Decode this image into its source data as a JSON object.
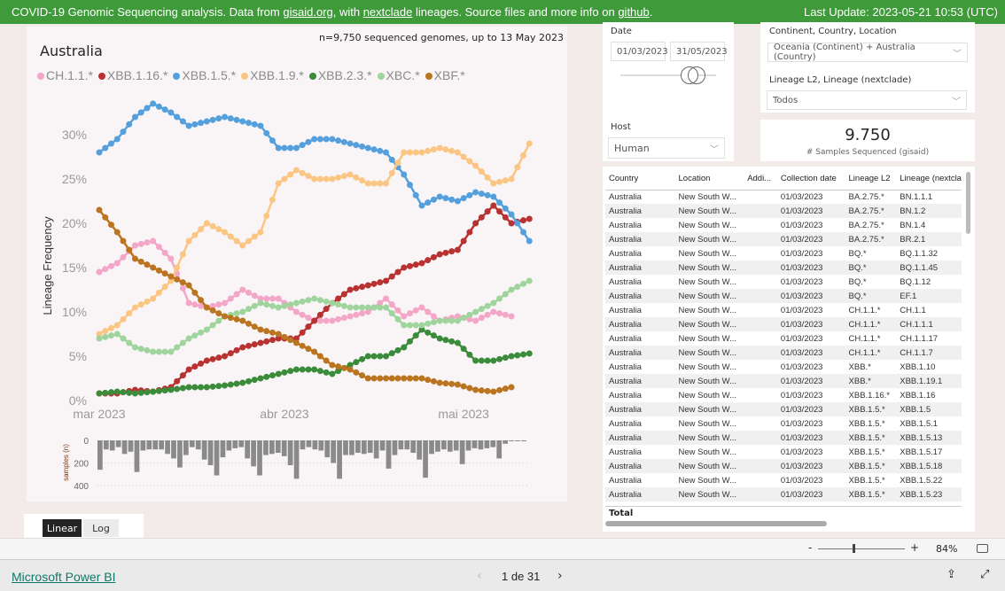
{
  "header": {
    "pre": "COVID-19 Genomic Sequencing analysis. Data from ",
    "link1": "gisaid.org",
    "mid": ", with ",
    "link2": "nextclade",
    "mid2": " lineages. Source files and more info on ",
    "link3": "github",
    "end": ".",
    "last_update": "Last Update: 2023-05-21 10:53 (UTC)"
  },
  "chart": {
    "title": "Australia",
    "count_text": "n=9,750 sequenced genomes, up to 13 May 2023",
    "ylabel": "Lineage Frequency",
    "bar_ylabel": "samples (n)"
  },
  "chart_data": {
    "type": "line",
    "ylabel": "Lineage Frequency",
    "yticks": [
      "0%",
      "5%",
      "10%",
      "15%",
      "20%",
      "25%",
      "30%"
    ],
    "ylim": [
      0,
      32
    ],
    "xticks": [
      "mar 2023",
      "abr 2023",
      "mai 2023"
    ],
    "x": [
      "2023-03-01",
      "2023-03-04",
      "2023-03-07",
      "2023-03-10",
      "2023-03-13",
      "2023-03-16",
      "2023-03-19",
      "2023-03-22",
      "2023-03-25",
      "2023-03-28",
      "2023-03-31",
      "2023-04-03",
      "2023-04-06",
      "2023-04-09",
      "2023-04-12",
      "2023-04-15",
      "2023-04-18",
      "2023-04-21",
      "2023-04-24",
      "2023-04-27",
      "2023-04-30",
      "2023-05-03",
      "2023-05-06",
      "2023-05-09",
      "2023-05-12"
    ],
    "series": [
      {
        "name": "CH.1.1.*",
        "color": "#f4a6c8",
        "values": [
          14.5,
          15.5,
          17.5,
          18,
          16,
          11,
          10.5,
          11,
          12.5,
          11.5,
          11.5,
          10,
          9,
          9,
          9.5,
          10,
          11.5,
          9.5,
          10.5,
          9,
          9.5,
          9,
          10,
          9.5,
          null
        ]
      },
      {
        "name": "XBB.1.16.*",
        "color": "#b83232",
        "values": [
          0.8,
          0.8,
          1.2,
          1,
          1.5,
          3.5,
          4.5,
          5,
          6,
          6.5,
          7,
          7,
          9,
          11,
          12.5,
          13,
          13.5,
          15,
          15.5,
          16.5,
          17,
          20,
          22,
          20,
          20.5
        ]
      },
      {
        "name": "XBB.1.5.*",
        "color": "#55a0dc",
        "values": [
          28,
          29.5,
          32,
          33.5,
          32.5,
          31,
          31.5,
          32,
          31.5,
          31,
          28.5,
          28.5,
          29.5,
          29.5,
          29,
          28.5,
          28,
          25.5,
          22,
          23,
          22.5,
          23.5,
          23,
          21,
          18
        ]
      },
      {
        "name": "XBB.1.9.*",
        "color": "#fbc683",
        "values": [
          7.5,
          8.5,
          10.5,
          11.5,
          13.5,
          18,
          20,
          19,
          17.5,
          19,
          24.5,
          26,
          25,
          25,
          25.5,
          24.5,
          24.5,
          28,
          28,
          28.5,
          28,
          26.5,
          24.5,
          25,
          29
        ]
      },
      {
        "name": "XBB.2.3.*",
        "color": "#3a8b3a",
        "values": [
          0.8,
          1,
          0.8,
          1,
          1.2,
          1.5,
          1.5,
          1.7,
          2,
          2.5,
          3,
          3.5,
          3.5,
          3,
          4,
          5,
          5,
          6,
          8,
          7,
          6.5,
          4.5,
          4.5,
          5,
          5.3
        ]
      },
      {
        "name": "XBC.*",
        "color": "#9fd59c",
        "values": [
          7,
          7.5,
          6,
          5.5,
          5.5,
          7,
          8,
          9.5,
          10,
          11,
          10.5,
          11,
          11.5,
          11,
          10.5,
          10.5,
          10.5,
          8.5,
          8.5,
          9,
          9,
          10,
          11,
          12.5,
          13.5
        ]
      },
      {
        "name": "XBF.*",
        "color": "#bb7420",
        "values": [
          21.5,
          19,
          16,
          15,
          14,
          13,
          10.5,
          9.5,
          9,
          8,
          7.5,
          6.5,
          5.5,
          4,
          3.5,
          2.5,
          2.5,
          2.5,
          2.5,
          2,
          1.8,
          1.2,
          1,
          1.5,
          null
        ]
      }
    ],
    "samples": {
      "yticks": [
        "0",
        "200",
        "400"
      ],
      "ylim": [
        0,
        400
      ],
      "values": [
        260,
        80,
        90,
        60,
        120,
        100,
        280,
        90,
        80,
        80,
        80,
        120,
        160,
        240,
        130,
        60,
        80,
        170,
        220,
        310,
        150,
        90,
        70,
        60,
        160,
        230,
        310,
        130,
        120,
        110,
        140,
        220,
        340,
        80,
        60,
        80,
        90,
        150,
        200,
        340,
        130,
        130,
        110,
        120,
        110,
        160,
        90,
        250,
        130,
        80,
        80,
        110,
        170,
        330,
        120,
        100,
        80,
        100,
        90,
        210,
        90,
        70,
        80,
        70,
        60,
        160,
        30,
        5,
        5,
        5
      ]
    }
  },
  "filters": {
    "date_label": "Date",
    "date_from": "01/03/2023",
    "date_to": "31/05/2023",
    "host_label": "Host",
    "host_value": "Human",
    "location_label": "Continent, Country, Location",
    "location_value": "Oceania (Continent) + Australia (Country)",
    "lineage_label": "Lineage L2, Lineage (nextclade)",
    "lineage_value": "Todos"
  },
  "kpi": {
    "value": "9.750",
    "label": "# Samples Sequenced (gisaid)"
  },
  "table": {
    "columns": [
      "Country",
      "Location",
      "Addi...",
      "Collection date",
      "Lineage L2",
      "Lineage (nextcla"
    ],
    "rows": [
      [
        "Australia",
        "New South W...",
        "",
        "01/03/2023",
        "BA.2.75.*",
        "BN.1.1.1"
      ],
      [
        "Australia",
        "New South W...",
        "",
        "01/03/2023",
        "BA.2.75.*",
        "BN.1.2"
      ],
      [
        "Australia",
        "New South W...",
        "",
        "01/03/2023",
        "BA.2.75.*",
        "BN.1.4"
      ],
      [
        "Australia",
        "New South W...",
        "",
        "01/03/2023",
        "BA.2.75.*",
        "BR.2.1"
      ],
      [
        "Australia",
        "New South W...",
        "",
        "01/03/2023",
        "BQ.*",
        "BQ.1.1.32"
      ],
      [
        "Australia",
        "New South W...",
        "",
        "01/03/2023",
        "BQ.*",
        "BQ.1.1.45"
      ],
      [
        "Australia",
        "New South W...",
        "",
        "01/03/2023",
        "BQ.*",
        "BQ.1.12"
      ],
      [
        "Australia",
        "New South W...",
        "",
        "01/03/2023",
        "BQ.*",
        "EF.1"
      ],
      [
        "Australia",
        "New South W...",
        "",
        "01/03/2023",
        "CH.1.1.*",
        "CH.1.1"
      ],
      [
        "Australia",
        "New South W...",
        "",
        "01/03/2023",
        "CH.1.1.*",
        "CH.1.1.1"
      ],
      [
        "Australia",
        "New South W...",
        "",
        "01/03/2023",
        "CH.1.1.*",
        "CH.1.1.17"
      ],
      [
        "Australia",
        "New South W...",
        "",
        "01/03/2023",
        "CH.1.1.*",
        "CH.1.1.7"
      ],
      [
        "Australia",
        "New South W...",
        "",
        "01/03/2023",
        "XBB.*",
        "XBB.1.10"
      ],
      [
        "Australia",
        "New South W...",
        "",
        "01/03/2023",
        "XBB.*",
        "XBB.1.19.1"
      ],
      [
        "Australia",
        "New South W...",
        "",
        "01/03/2023",
        "XBB.1.16.*",
        "XBB.1.16"
      ],
      [
        "Australia",
        "New South W...",
        "",
        "01/03/2023",
        "XBB.1.5.*",
        "XBB.1.5"
      ],
      [
        "Australia",
        "New South W...",
        "",
        "01/03/2023",
        "XBB.1.5.*",
        "XBB.1.5.1"
      ],
      [
        "Australia",
        "New South W...",
        "",
        "01/03/2023",
        "XBB.1.5.*",
        "XBB.1.5.13"
      ],
      [
        "Australia",
        "New South W...",
        "",
        "01/03/2023",
        "XBB.1.5.*",
        "XBB.1.5.17"
      ],
      [
        "Australia",
        "New South W...",
        "",
        "01/03/2023",
        "XBB.1.5.*",
        "XBB.1.5.18"
      ],
      [
        "Australia",
        "New South W...",
        "",
        "01/03/2023",
        "XBB.1.5.*",
        "XBB.1.5.22"
      ],
      [
        "Australia",
        "New South W...",
        "",
        "01/03/2023",
        "XBB.1.5.*",
        "XBB.1.5.23"
      ]
    ],
    "total_label": "Total"
  },
  "scale_toggle": {
    "linear": "Linear",
    "log": "Log"
  },
  "zoom": {
    "minus": "-",
    "plus": "+",
    "value": "84%"
  },
  "footer": {
    "brand": "Microsoft Power BI",
    "page": "1 de 31"
  }
}
